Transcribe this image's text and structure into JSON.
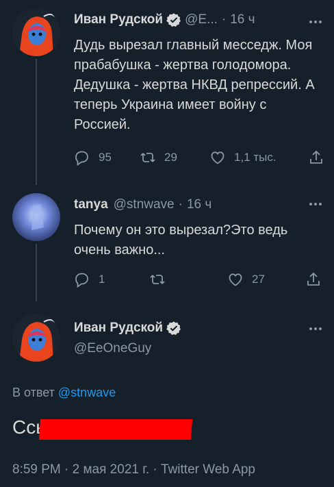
{
  "tweet1": {
    "name": "Иван Рудской",
    "handle": "@E...",
    "time": "16 ч",
    "text": "Дудь вырезал главный месседж. Моя прабабушка - жертва голодомора. Дедушка - жертва НКВД репрессий. А теперь Украина имеет войну с Россией.",
    "replies": "95",
    "retweets": "29",
    "likes": "1,1 тыс."
  },
  "tweet2": {
    "name": "tanya",
    "handle": "@stnwave",
    "time": "16 ч",
    "text": "Почему он это вырезал?Это ведь очень важно...",
    "replies": "1",
    "retweets": "",
    "likes": "27"
  },
  "main": {
    "name": "Иван Рудской",
    "handle": "@EeOneGuy",
    "reply_prefix": "В ответ",
    "reply_handle": "@stnwave",
    "text": "Ссы",
    "meta": "8:59 PM · 2 мая 2021 г. · Twitter Web App"
  },
  "colors": {
    "background": "#15202b",
    "accent": "#1d9bf0",
    "muted": "#8b98a5",
    "redaction": "#ff0000"
  },
  "icons": [
    "verified-badge-icon",
    "more-icon",
    "reply-icon",
    "retweet-icon",
    "like-icon",
    "share-icon"
  ]
}
